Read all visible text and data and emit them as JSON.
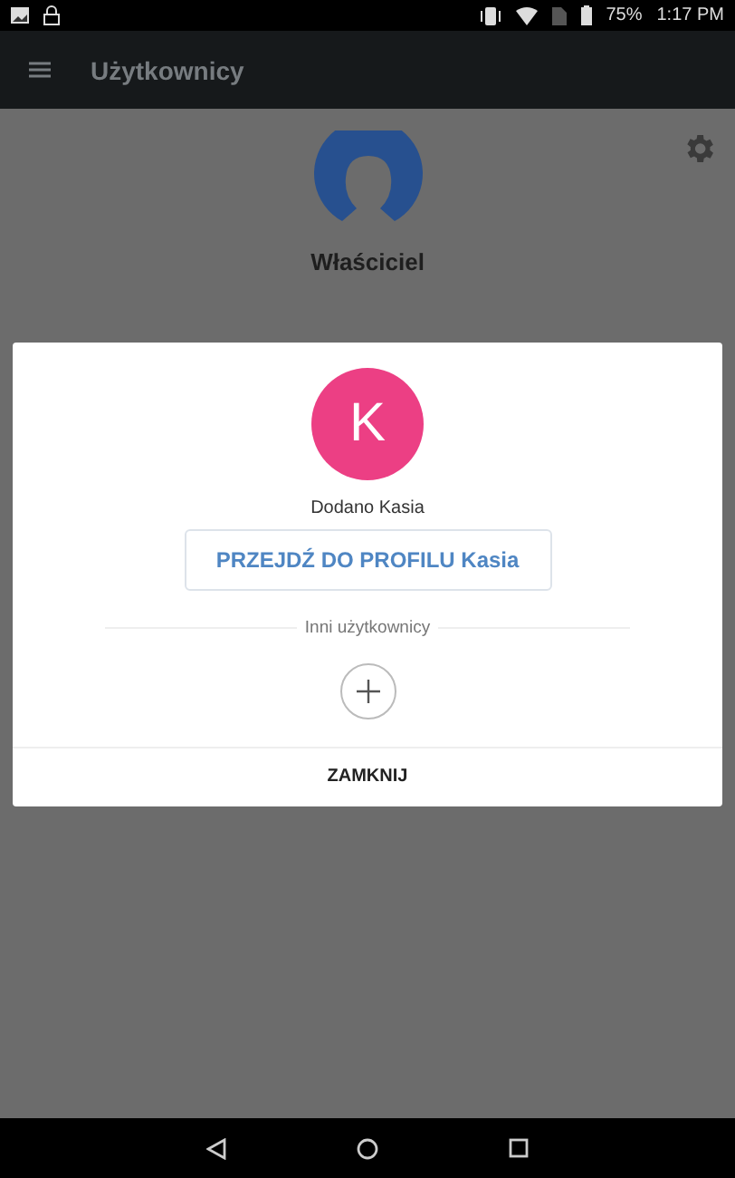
{
  "status_bar": {
    "battery": "75%",
    "time": "1:17 PM"
  },
  "app_bar": {
    "title": "Użytkownicy"
  },
  "owner": {
    "name": "Właściciel"
  },
  "dialog": {
    "avatar_letter": "K",
    "message": "Dodano Kasia",
    "profile_button": "PRZEJDŹ DO PROFILU Kasia",
    "section_label": "Inni użytkownicy",
    "close_button": "ZAMKNIJ"
  }
}
